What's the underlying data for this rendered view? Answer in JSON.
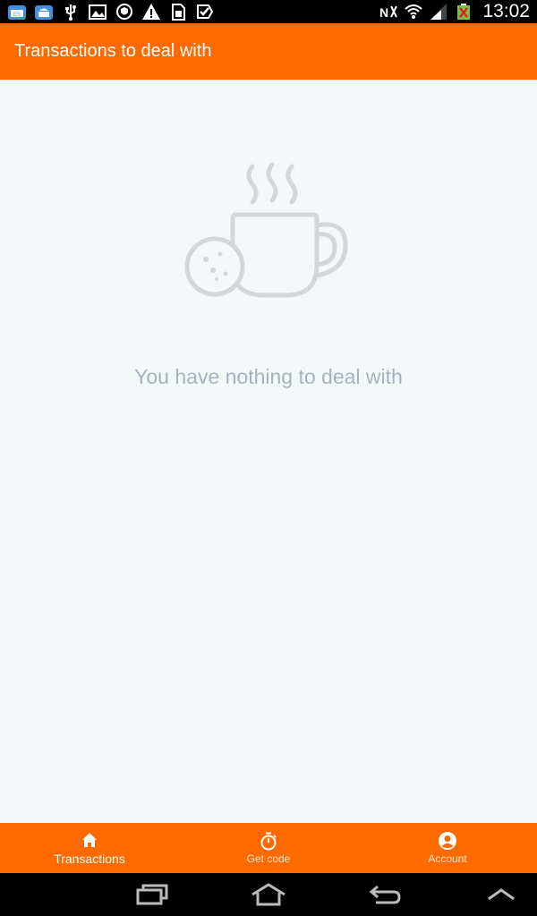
{
  "status_bar": {
    "time": "13:02",
    "left_icons": [
      "notification-app-icon",
      "cloud-notification-icon",
      "usb-icon",
      "image-icon",
      "vpn-shield-icon",
      "warning-icon",
      "sim-card-icon",
      "check-notification-icon"
    ],
    "right_icons": [
      "nfc-icon",
      "wifi-icon",
      "signal-icon",
      "battery-icon"
    ]
  },
  "app_bar": {
    "title": "Transactions to deal with"
  },
  "empty_state": {
    "illustration": "coffee-cup-cookie-icon",
    "message": "You have nothing to deal with"
  },
  "bottom_nav": {
    "items": [
      {
        "label": "Transactions",
        "icon": "home-icon",
        "active": true
      },
      {
        "label": "Get code",
        "icon": "timer-icon",
        "active": false
      },
      {
        "label": "Account",
        "icon": "account-icon",
        "active": false
      }
    ]
  },
  "system_nav": {
    "buttons": [
      "recent-apps-icon",
      "home-icon",
      "back-icon",
      "menu-up-icon"
    ]
  },
  "colors": {
    "accent": "#ff6a00",
    "background": "#f4f8f9",
    "muted_text": "#a6b2be"
  }
}
